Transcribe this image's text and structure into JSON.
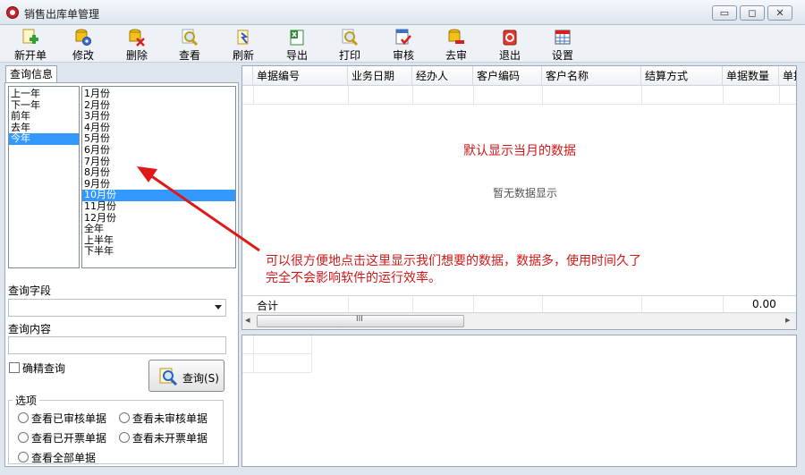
{
  "window": {
    "title": "销售出库单管理",
    "controls": [
      "▭",
      "◻",
      "✕"
    ]
  },
  "toolbar": {
    "buttons": [
      {
        "label": "新开单",
        "icon": "new-document-icon"
      },
      {
        "label": "修改",
        "icon": "edit-gear-icon"
      },
      {
        "label": "删除",
        "icon": "delete-icon"
      },
      {
        "label": "查看",
        "icon": "magnifier-icon"
      },
      {
        "label": "刷新",
        "icon": "refresh-icon"
      },
      {
        "label": "导出",
        "icon": "excel-export-icon"
      },
      {
        "label": "打印",
        "icon": "print-preview-icon"
      },
      {
        "label": "审核",
        "icon": "approve-icon"
      },
      {
        "label": "去审",
        "icon": "unapprove-icon"
      },
      {
        "label": "退出",
        "icon": "exit-icon"
      },
      {
        "label": "设置",
        "icon": "settings-grid-icon"
      }
    ]
  },
  "left": {
    "tab_label": "查询信息",
    "years": [
      "上一年",
      "下一年",
      "前年",
      "去年",
      "今年"
    ],
    "year_selected": 4,
    "months": [
      "1月份",
      "2月份",
      "3月份",
      "4月份",
      "5月份",
      "6月份",
      "7月份",
      "8月份",
      "9月份",
      "10月份",
      "11月份",
      "12月份",
      "全年",
      "上半年",
      "下半年"
    ],
    "month_selected": 9,
    "query_field_label": "查询字段",
    "query_field_value": "",
    "query_content_label": "查询内容",
    "query_content_value": "",
    "exact_label": "确精查询",
    "query_button": "查询(S)",
    "options_title": "选项",
    "options": [
      "查看已审核单据",
      "查看未审核单据",
      "查看已开票单据",
      "查看未开票单据",
      "查看全部单据"
    ]
  },
  "grid": {
    "columns": [
      "单据编号",
      "业务日期",
      "经办人",
      "客户编码",
      "客户名称",
      "结算方式",
      "单据数量",
      "单据"
    ],
    "default_note": "默认显示当月的数据",
    "no_data": "暂无数据显示",
    "total_label": "合计",
    "total_value": "0.00",
    "scroll_grip": "III",
    "scroll_left": "◂",
    "scroll_right": "▸"
  },
  "annotation": {
    "line1": "可以很方便地点击这里显示我们想要的数据，数据多，使用时间久了",
    "line2": "完全不会影响软件的运行效率。"
  },
  "colors": {
    "accent": "#3399ff",
    "annotation": "#d01818"
  }
}
